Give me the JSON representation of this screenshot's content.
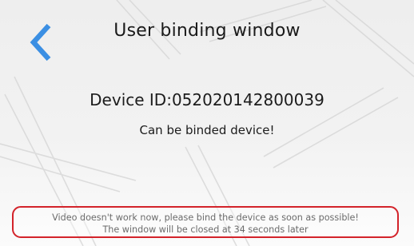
{
  "header": {
    "back_icon": "chevron-left-icon",
    "title": "User binding window"
  },
  "device": {
    "id_text": "Device ID:052020142800039",
    "status_text": "Can be binded device!"
  },
  "notice": {
    "line1": "Video doesn't work now, please bind the device as soon as possible!",
    "line2": "The window will be closed at 34 seconds later"
  },
  "colors": {
    "accent": "#3b8fe3",
    "notice_border": "#d3232a"
  }
}
